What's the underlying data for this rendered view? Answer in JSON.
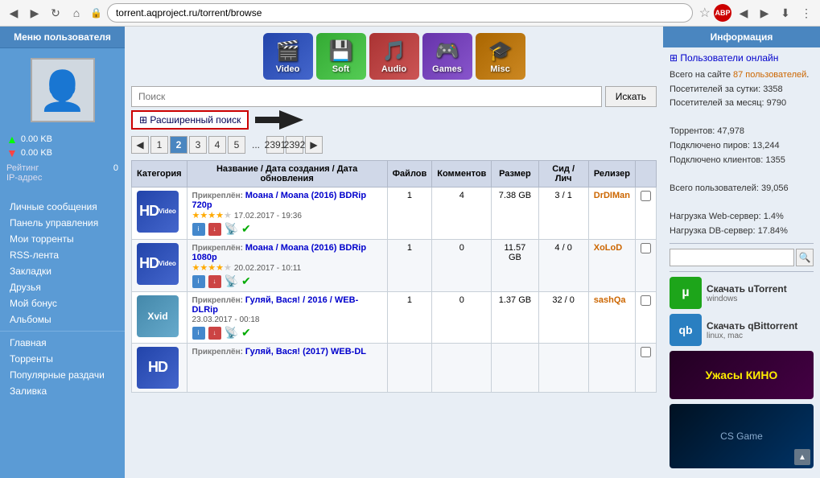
{
  "browser": {
    "url": "torrent.aqproject.ru/torrent/browse",
    "back_btn": "◀",
    "forward_btn": "▶",
    "reload_btn": "↻",
    "home_btn": "⌂"
  },
  "left_sidebar": {
    "title": "Меню пользователя",
    "upload_speed": "0.00 KB",
    "download_speed": "0.00 KB",
    "rating_label": "Рейтинг",
    "rating_value": "0",
    "ip_label": "IP-адрес",
    "ip_value": "",
    "menu_items": [
      "Личные сообщения",
      "Панель управления",
      "Мои торренты",
      "RSS-лента",
      "Закладки",
      "Друзья",
      "Мой бонус",
      "Альбомы"
    ],
    "bottom_menu": [
      "Главная",
      "Торренты",
      "Популярные раздачи",
      "Заливка"
    ]
  },
  "categories": [
    {
      "id": "video",
      "label": "Video",
      "icon": "🎬"
    },
    {
      "id": "soft",
      "label": "Soft",
      "icon": "💾"
    },
    {
      "id": "audio",
      "label": "Audio",
      "icon": "🎵"
    },
    {
      "id": "games",
      "label": "Games",
      "icon": "🎮"
    },
    {
      "id": "misc",
      "label": "Misc",
      "icon": "🎓"
    }
  ],
  "search": {
    "placeholder": "Поиск",
    "button_label": "Искать",
    "advanced_label": "⊞ Расширенный поиск"
  },
  "pagination": {
    "prev": "◀",
    "next": "▶",
    "pages": [
      "1",
      "2",
      "3",
      "4",
      "5",
      "...",
      "2391",
      "2392"
    ]
  },
  "table": {
    "headers": [
      "Категория",
      "Название / Дата создания / Дата обновления",
      "Файлов",
      "Комментов",
      "Размер",
      "Сид / Лич",
      "Релизер",
      ""
    ],
    "rows": [
      {
        "cat": "HD Video",
        "cat_style": "hd",
        "title": "Прикреплён: Моана / Moana (2016) BDRip 720p",
        "stars": "★★★★☆",
        "date": "17.02.2017 -",
        "time": "19:36",
        "files": "1",
        "comments": "4",
        "size": "7.38 GB",
        "seeds": "3",
        "leech": "1",
        "relizer": "DrDIMan",
        "relizer_color": "#cc6600"
      },
      {
        "cat": "HD Video",
        "cat_style": "hd",
        "title": "Прикреплён: Моана / Moana (2016) BDRip 1080p",
        "stars": "★★★★☆",
        "date": "20.02.2017 -",
        "time": "10:11",
        "files": "1",
        "comments": "0",
        "size": "11.57 GB",
        "seeds": "4",
        "leech": "0",
        "relizer": "XoLoD",
        "relizer_color": "#cc6600"
      },
      {
        "cat": "Xvid",
        "cat_style": "xvid",
        "title": "Прикреплён: Гуляй, Вася! / 2016 / WEB-DLRip",
        "stars": "",
        "date": "23.03.2017 -",
        "time": "00:18",
        "files": "1",
        "comments": "0",
        "size": "1.37 GB",
        "seeds": "32",
        "leech": "0",
        "relizer": "sashQa",
        "relizer_color": "#cc6600"
      },
      {
        "cat": "HD",
        "cat_style": "hd",
        "title": "Прикреплён: Гуляй, Вася! (2017) WEB-DL",
        "stars": "",
        "date": "",
        "time": "",
        "files": "",
        "comments": "",
        "size": "",
        "seeds": "",
        "leech": "",
        "relizer": "",
        "relizer_color": "#cc6600"
      }
    ]
  },
  "right_sidebar": {
    "title": "Информация",
    "online_link": "⊞ Пользователи онлайн",
    "stats": [
      "Всего на сайте 87 пользователей.",
      "Посетителей за сутки: 3358",
      "Посетителей за месяц: 9790",
      "",
      "Торрентов: 47,978",
      "Подключено пиров: 13,244",
      "Подключено клиентов: 1355",
      "",
      "Всего пользователей: 39,056",
      "",
      "Нагрузка Web-сервер: 1.4%",
      "Нагрузка DB-сервер: 17.84%"
    ],
    "utorrent_label": "Скачать uTorrent",
    "utorrent_sub": "windows",
    "qbittorrent_label": "Скачать qBittorrent",
    "qbittorrent_sub": "linux, mac",
    "film_label": "Ужасы КИНО"
  }
}
